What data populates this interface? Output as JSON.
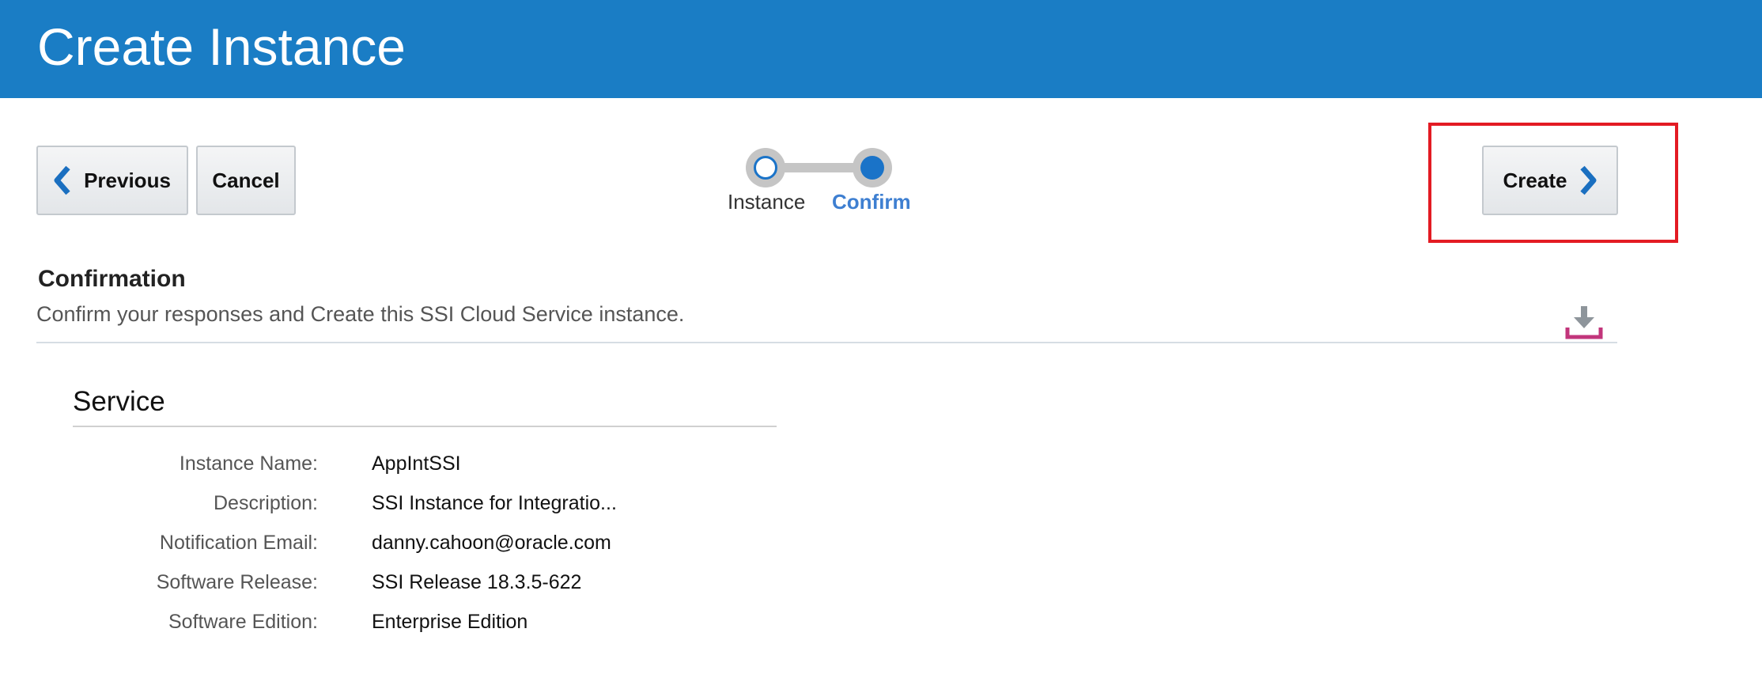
{
  "header": {
    "title": "Create Instance"
  },
  "toolbar": {
    "previous_label": "Previous",
    "cancel_label": "Cancel",
    "create_label": "Create"
  },
  "train": {
    "steps": [
      {
        "label": "Instance",
        "state": "visited"
      },
      {
        "label": "Confirm",
        "state": "current"
      }
    ]
  },
  "confirmation": {
    "title": "Confirmation",
    "description": "Confirm your responses and Create this SSI Cloud Service instance.",
    "download_icon": "download-icon"
  },
  "service": {
    "title": "Service",
    "fields": [
      {
        "label": "Instance Name:",
        "value": "AppIntSSI"
      },
      {
        "label": "Description:",
        "value": "SSI Instance for Integratio..."
      },
      {
        "label": "Notification Email:",
        "value": "danny.cahoon@oracle.com"
      },
      {
        "label": "Software Release:",
        "value": "SSI Release 18.3.5-622"
      },
      {
        "label": "Software Edition:",
        "value": "Enterprise Edition"
      }
    ]
  },
  "colors": {
    "header_bg": "#1a7dc5",
    "accent": "#1a73c8",
    "highlight": "#e31b23",
    "download_tray": "#c2357b"
  }
}
